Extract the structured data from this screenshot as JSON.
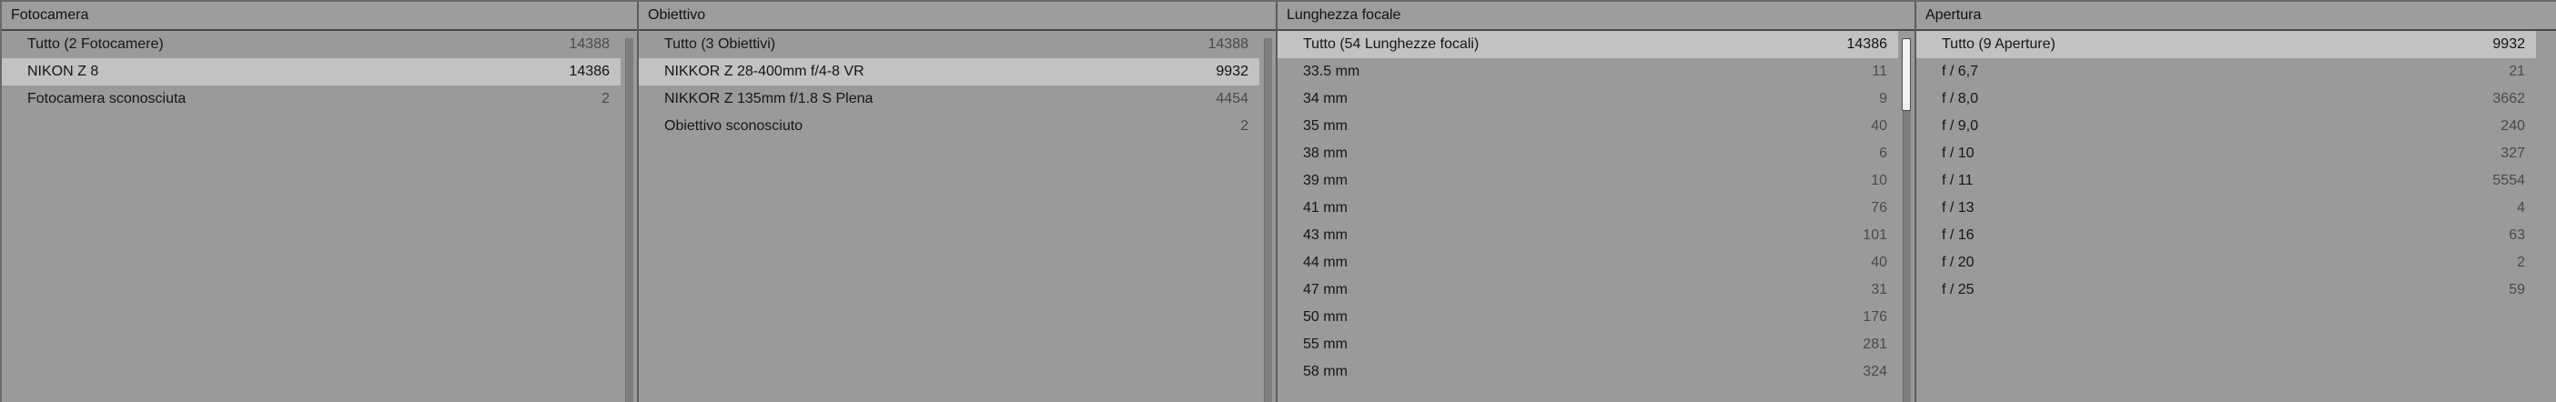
{
  "columns": [
    {
      "header": "Fotocamera",
      "rows": [
        {
          "label": "Tutto (2 Fotocamere)",
          "count": "14388"
        },
        {
          "label": "NIKON Z 8",
          "count": "14386"
        },
        {
          "label": "Fotocamera sconosciuta",
          "count": "2"
        }
      ]
    },
    {
      "header": "Obiettivo",
      "rows": [
        {
          "label": "Tutto (3 Obiettivi)",
          "count": "14388"
        },
        {
          "label": "NIKKOR Z 28-400mm f/4-8 VR",
          "count": "9932"
        },
        {
          "label": "NIKKOR Z 135mm f/1.8 S Plena",
          "count": "4454"
        },
        {
          "label": "Obiettivo sconosciuto",
          "count": "2"
        }
      ]
    },
    {
      "header": "Lunghezza focale",
      "rows": [
        {
          "label": "Tutto (54 Lunghezze focali)",
          "count": "14386"
        },
        {
          "label": "33.5 mm",
          "count": "11"
        },
        {
          "label": "34 mm",
          "count": "9"
        },
        {
          "label": "35 mm",
          "count": "40"
        },
        {
          "label": "38 mm",
          "count": "6"
        },
        {
          "label": "39 mm",
          "count": "10"
        },
        {
          "label": "41 mm",
          "count": "76"
        },
        {
          "label": "43 mm",
          "count": "101"
        },
        {
          "label": "44 mm",
          "count": "40"
        },
        {
          "label": "47 mm",
          "count": "31"
        },
        {
          "label": "50 mm",
          "count": "176"
        },
        {
          "label": "55 mm",
          "count": "281"
        },
        {
          "label": "58 mm",
          "count": "324"
        }
      ]
    },
    {
      "header": "Apertura",
      "rows": [
        {
          "label": "Tutto (9 Aperture)",
          "count": "9932"
        },
        {
          "label": "f / 6,7",
          "count": "21"
        },
        {
          "label": "f / 8,0",
          "count": "3662"
        },
        {
          "label": "f / 9,0",
          "count": "240"
        },
        {
          "label": "f / 10",
          "count": "327"
        },
        {
          "label": "f / 11",
          "count": "5554"
        },
        {
          "label": "f / 13",
          "count": "4"
        },
        {
          "label": "f / 16",
          "count": "63"
        },
        {
          "label": "f / 20",
          "count": "2"
        },
        {
          "label": "f / 25",
          "count": "59"
        }
      ]
    }
  ]
}
